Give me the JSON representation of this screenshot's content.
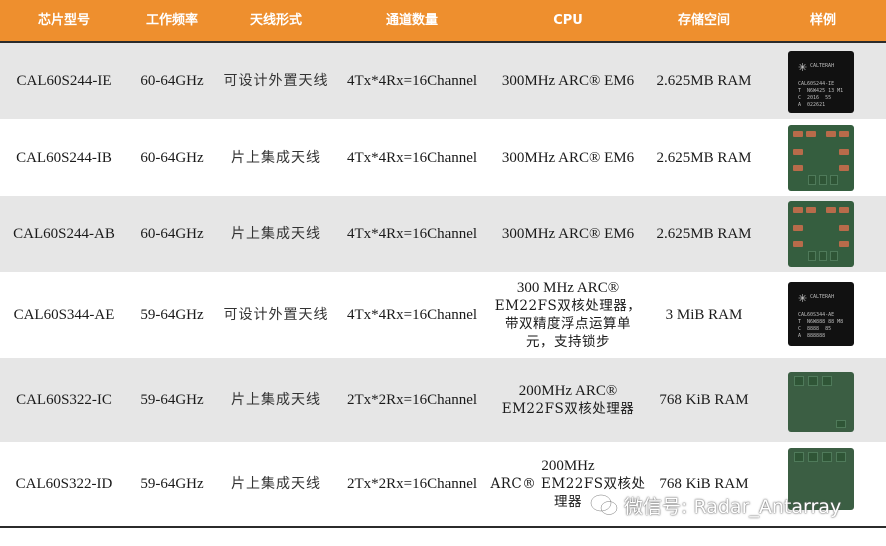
{
  "headers": [
    "芯片型号",
    "工作频率",
    "天线形式",
    "通道数量",
    "CPU",
    "存储空间",
    "样例"
  ],
  "rows": [
    {
      "model": "CAL60S244-IE",
      "freq": "60-64GHz",
      "antenna": "可设计外置天线",
      "channels": "4Tx*4Rx=16Channel",
      "cpu": [
        "300MHz ARC® EM6"
      ],
      "memory": "2.625MB RAM",
      "sample": {
        "style": "black",
        "brand": "CALTERAH",
        "lines": [
          "CAL60S244-IE",
          "T  N6W425 13 M1",
          "C  2016  55",
          "A  022621"
        ]
      }
    },
    {
      "model": "CAL60S244-IB",
      "freq": "60-64GHz",
      "antenna": "片上集成天线",
      "channels": "4Tx*4Rx=16Channel",
      "cpu": [
        "300MHz ARC® EM6"
      ],
      "memory": "2.625MB RAM",
      "sample": {
        "style": "green-pads"
      }
    },
    {
      "model": "CAL60S244-AB",
      "freq": "60-64GHz",
      "antenna": "片上集成天线",
      "channels": "4Tx*4Rx=16Channel",
      "cpu": [
        "300MHz ARC® EM6"
      ],
      "memory": "2.625MB RAM",
      "sample": {
        "style": "green-pads"
      }
    },
    {
      "model": "CAL60S344-AE",
      "freq": "59-64GHz",
      "antenna": "可设计外置天线",
      "channels": "4Tx*4Rx=16Channel",
      "cpu": [
        "300 MHz ARC®",
        "EM22FS双核处理器，",
        "带双精度浮点运算单",
        "元，支持锁步"
      ],
      "memory": "3 MiB RAM",
      "sample": {
        "style": "black",
        "brand": "CALTERAH",
        "lines": [
          "CAL60S344-AE",
          "T  N6W888 88 M8",
          "C  8888  85",
          "A  888888"
        ]
      }
    },
    {
      "model": "CAL60S322-IC",
      "freq": "59-64GHz",
      "antenna": "片上集成天线",
      "channels": "2Tx*2Rx=16Channel",
      "cpu": [
        "200MHz ARC®",
        "EM22FS双核处理器"
      ],
      "memory": "768 KiB RAM",
      "sample": {
        "style": "green-plain"
      }
    },
    {
      "model": "CAL60S322-ID",
      "freq": "59-64GHz",
      "antenna": "片上集成天线",
      "channels": "2Tx*2Rx=16Channel",
      "cpu": [
        "200MHz",
        "ARC® EM22FS双核处",
        "理器"
      ],
      "memory": "768 KiB RAM",
      "sample": {
        "style": "green-plain"
      }
    }
  ],
  "watermark": "微信号: Radar_Antarray",
  "colors": {
    "header": "#ee8f2e",
    "shade": "#e6e6e6",
    "rule": "#2b2b2b"
  }
}
